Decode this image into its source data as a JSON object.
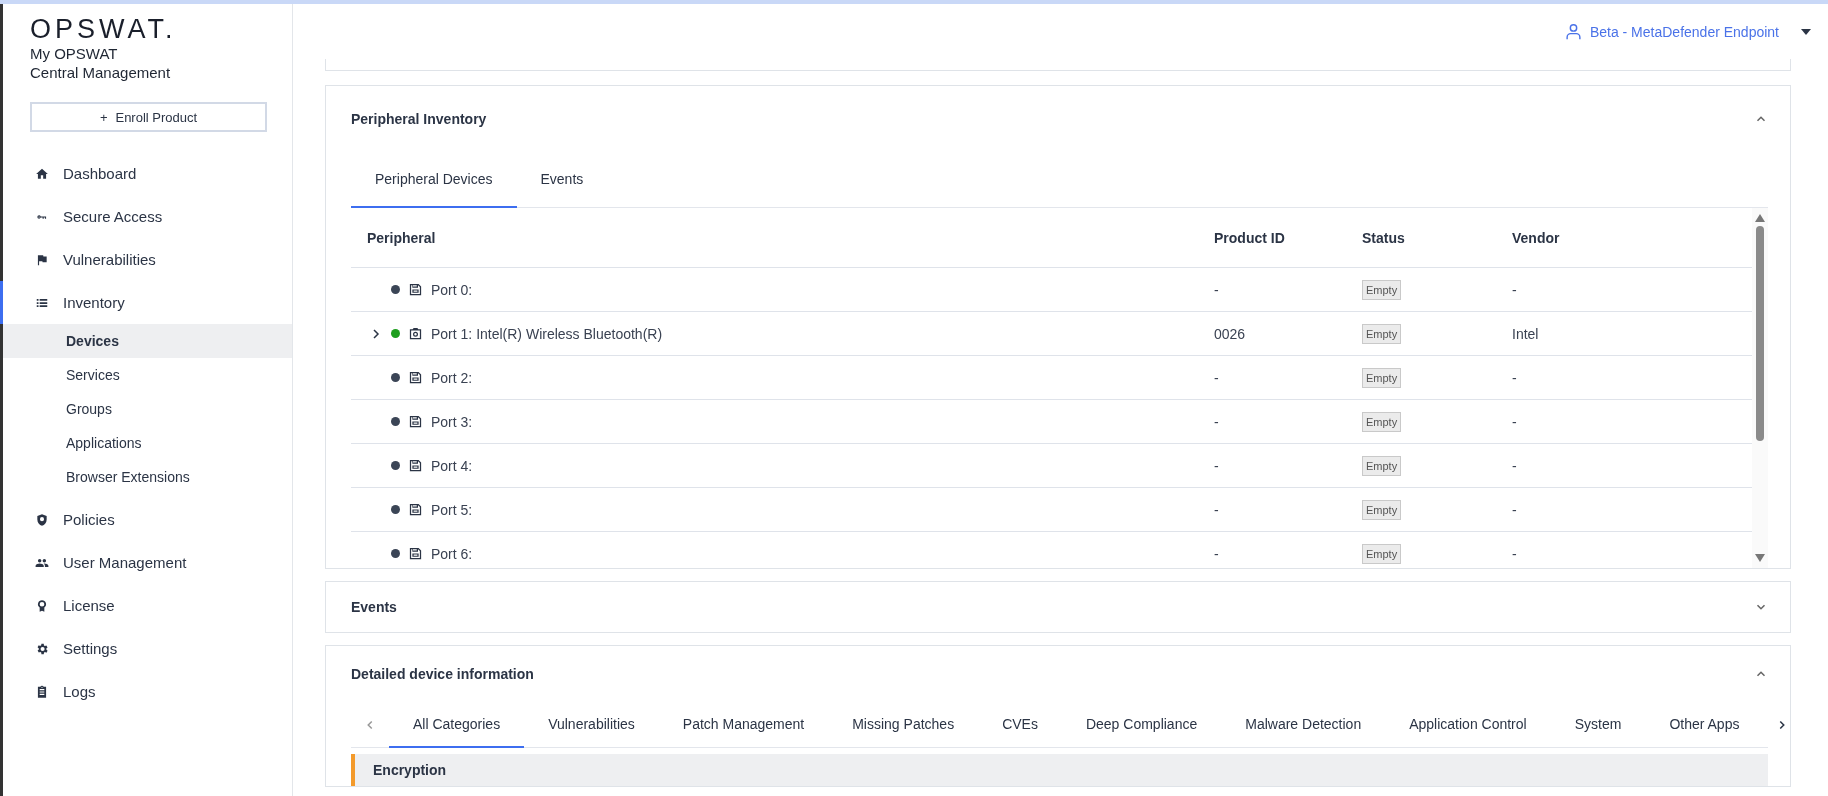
{
  "brand": {
    "logo": "OPSWAT.",
    "subtitle": "My OPSWAT",
    "product": "Central Management"
  },
  "enroll_button": {
    "icon": "+",
    "label": "Enroll Product"
  },
  "sidebar": {
    "items": [
      {
        "label": "Dashboard",
        "selected": false
      },
      {
        "label": "Secure Access",
        "selected": false
      },
      {
        "label": "Vulnerabilities",
        "selected": false
      },
      {
        "label": "Inventory",
        "selected": true,
        "children": [
          {
            "label": "Devices",
            "selected": true
          },
          {
            "label": "Services",
            "selected": false
          },
          {
            "label": "Groups",
            "selected": false
          },
          {
            "label": "Applications",
            "selected": false
          },
          {
            "label": "Browser Extensions",
            "selected": false
          }
        ]
      },
      {
        "label": "Policies",
        "selected": false
      },
      {
        "label": "User Management",
        "selected": false
      },
      {
        "label": "License",
        "selected": false
      },
      {
        "label": "Settings",
        "selected": false
      },
      {
        "label": "Logs",
        "selected": false
      }
    ]
  },
  "account": {
    "label": "Beta - MetaDefender Endpoint"
  },
  "peripheral_inventory": {
    "title": "Peripheral Inventory",
    "expanded": true,
    "tabs": [
      {
        "label": "Peripheral Devices",
        "selected": true
      },
      {
        "label": "Events",
        "selected": false
      }
    ],
    "columns": [
      "Peripheral",
      "Product ID",
      "Status",
      "Vendor"
    ],
    "rows": [
      {
        "kind": "storage",
        "expandable": false,
        "color": "#3b4556",
        "name": "Port 0:",
        "product_id": "-",
        "status": "Empty",
        "vendor": "-"
      },
      {
        "kind": "camera",
        "expandable": true,
        "color": "#1e9e1e",
        "name": "Port 1: Intel(R) Wireless Bluetooth(R)",
        "product_id": "0026",
        "status": "Empty",
        "vendor": "Intel"
      },
      {
        "kind": "storage",
        "expandable": false,
        "color": "#3b4556",
        "name": "Port 2:",
        "product_id": "-",
        "status": "Empty",
        "vendor": "-"
      },
      {
        "kind": "storage",
        "expandable": false,
        "color": "#3b4556",
        "name": "Port 3:",
        "product_id": "-",
        "status": "Empty",
        "vendor": "-"
      },
      {
        "kind": "storage",
        "expandable": false,
        "color": "#3b4556",
        "name": "Port 4:",
        "product_id": "-",
        "status": "Empty",
        "vendor": "-"
      },
      {
        "kind": "storage",
        "expandable": false,
        "color": "#3b4556",
        "name": "Port 5:",
        "product_id": "-",
        "status": "Empty",
        "vendor": "-"
      },
      {
        "kind": "storage",
        "expandable": false,
        "color": "#3b4556",
        "name": "Port 6:",
        "product_id": "-",
        "status": "Empty",
        "vendor": "-"
      }
    ]
  },
  "events": {
    "title": "Events",
    "expanded": false
  },
  "detailed_info": {
    "title": "Detailed device information",
    "expanded": true,
    "tabs": [
      {
        "label": "All Categories",
        "selected": true
      },
      {
        "label": "Vulnerabilities",
        "selected": false
      },
      {
        "label": "Patch Management",
        "selected": false
      },
      {
        "label": "Missing Patches",
        "selected": false
      },
      {
        "label": "CVEs",
        "selected": false
      },
      {
        "label": "Deep Compliance",
        "selected": false
      },
      {
        "label": "Malware Detection",
        "selected": false
      },
      {
        "label": "Application Control",
        "selected": false
      },
      {
        "label": "System",
        "selected": false
      },
      {
        "label": "Other Apps",
        "selected": false
      }
    ],
    "sections": [
      {
        "title": "Encryption"
      }
    ]
  }
}
